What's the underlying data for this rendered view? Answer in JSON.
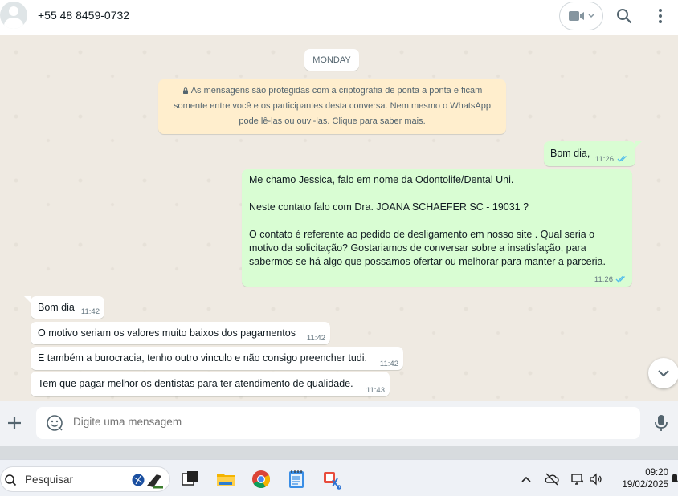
{
  "header": {
    "contact_name": "+55 48 8459-0732",
    "icons": [
      "avatar",
      "video-call-icon",
      "chevron-down-icon",
      "search-icon",
      "menu-icon"
    ]
  },
  "chat": {
    "day_label": "MONDAY",
    "encryption_notice": "As mensagens são protegidas com a criptografia de ponta a ponta e ficam somente entre você e os participantes desta conversa. Nem mesmo o WhatsApp pode lê-las ou ouvi-las. Clique para saber mais.",
    "messages": [
      {
        "direction": "outgoing",
        "text": "Bom dia,",
        "time": "11:26",
        "status": "read"
      },
      {
        "direction": "outgoing",
        "text": "Me chamo Jessica, falo em nome da Odontolife/Dental Uni.\n\nNeste contato falo com Dra. JOANA SCHAEFER SC - 19031 ?\n\nO contato é referente ao pedido de desligamento em nosso site . Qual seria o motivo da solicitação? Gostariamos de conversar sobre a insatisfação, para sabermos se há algo que possamos ofertar ou melhorar para manter a parceria.",
        "time": "11:26",
        "status": "read"
      },
      {
        "direction": "incoming",
        "text": "Bom dia",
        "time": "11:42"
      },
      {
        "direction": "incoming",
        "text": "O motivo seriam os valores muito baixos dos pagamentos",
        "time": "11:42"
      },
      {
        "direction": "incoming",
        "text": "E também a burocracia, tenho outro vinculo e não consigo preencher tudi.",
        "time": "11:42"
      },
      {
        "direction": "incoming",
        "text": "Tem que pagar melhor os dentistas para ter atendimento de qualidade.",
        "time": "11:43"
      }
    ]
  },
  "composer": {
    "placeholder": "Digite uma mensagem"
  },
  "taskbar": {
    "search_label": "Pesquisar",
    "apps": [
      "task-view-icon",
      "file-explorer-icon",
      "chrome-icon",
      "notepad-icon",
      "snipping-tool-icon"
    ],
    "tray": [
      "chevron-up-icon",
      "onedrive-icon",
      "network-icon",
      "volume-icon"
    ],
    "time": "09:20",
    "date": "19/02/2025"
  },
  "colors": {
    "outgoing_bubble": "#d9fdd3",
    "incoming_bubble": "#ffffff",
    "chat_background": "#efeae2",
    "encryption_background": "#ffeecd",
    "read_ticks": "#53bdeb"
  }
}
